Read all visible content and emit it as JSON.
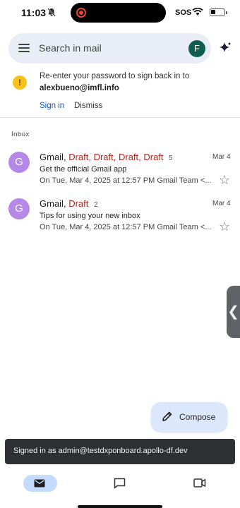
{
  "status_bar": {
    "time": "11:03",
    "sos": "SOS",
    "icons": [
      "bell-off-icon",
      "screen-record-icon",
      "wifi-icon",
      "battery-icon"
    ]
  },
  "search": {
    "placeholder": "Search in mail",
    "account_initial": "F",
    "icons": [
      "menu-icon",
      "gemini-sparkle-icon"
    ]
  },
  "prompt": {
    "icon": "!",
    "message": "Re-enter your password to sign back in to",
    "email": "alexbueno@imfl.info",
    "signin_label": "Sign in",
    "dismiss_label": "Dismiss"
  },
  "inbox": {
    "label": "Inbox",
    "emails": [
      {
        "avatar": "G",
        "sender": "Gmail,",
        "drafts": "Draft, Draft, Draft, Draft",
        "count": "5",
        "date": "Mar 4",
        "subject": "Get the official Gmail app",
        "preview": "On Tue, Mar 4, 2025 at 12:57 PM Gmail Team <..."
      },
      {
        "avatar": "G",
        "sender": "Gmail,",
        "drafts": "Draft",
        "count": "2",
        "date": "Mar 4",
        "subject": "Tips for using your new inbox",
        "preview": "On Tue, Mar 4, 2025 at 12:57 PM Gmail Team <..."
      }
    ]
  },
  "side_handle": "❮",
  "compose": {
    "label": "Compose"
  },
  "snackbar": {
    "text": "Signed in as admin@testdxponboard.apollo-df.dev"
  },
  "bottom_nav": {
    "items": [
      "mail-icon",
      "chat-icon",
      "meet-video-icon"
    ],
    "selected": "mail-icon"
  },
  "colors": {
    "search_bg": "#e9eef6",
    "account_avatar": "#0f5e4f",
    "warning": "#f9c21a",
    "link": "#0b57d0",
    "draft": "#b3261e",
    "sender_avatar": "#b688e8",
    "compose_bg": "#dbe8fb",
    "snackbar_bg": "#2f3033",
    "nav_selected": "#c2dbff"
  }
}
